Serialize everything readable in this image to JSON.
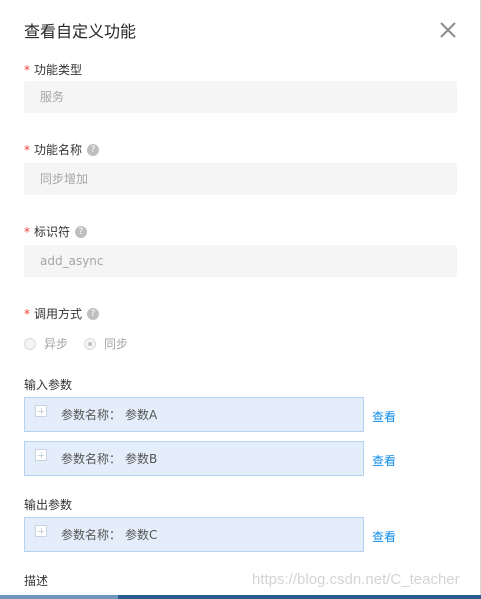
{
  "dialog": {
    "title": "查看自定义功能",
    "fields": {
      "type": {
        "label": "功能类型",
        "value": "服务"
      },
      "name": {
        "label": "功能名称",
        "value": "同步增加"
      },
      "identifier": {
        "label": "标识符",
        "value": "add_async"
      },
      "call_mode": {
        "label": "调用方式",
        "options": [
          "异步",
          "同步"
        ],
        "selected": "同步"
      }
    },
    "input_params": {
      "label": "输入参数",
      "items": [
        {
          "key_label": "参数名称：",
          "value": "参数A",
          "action": "查看"
        },
        {
          "key_label": "参数名称：",
          "value": "参数B",
          "action": "查看"
        }
      ]
    },
    "output_params": {
      "label": "输出参数",
      "items": [
        {
          "key_label": "参数名称：",
          "value": "参数C",
          "action": "查看"
        }
      ]
    },
    "description": {
      "label": "描述"
    },
    "help_glyph": "?"
  },
  "watermark": "https://blog.csdn.net/C_teacher",
  "icons": [
    "close-icon",
    "help-icon",
    "expand-plus-icon"
  ],
  "colors": {
    "link": "#108ee9",
    "required": "#f04134",
    "param_bg": "#e3eefa"
  }
}
